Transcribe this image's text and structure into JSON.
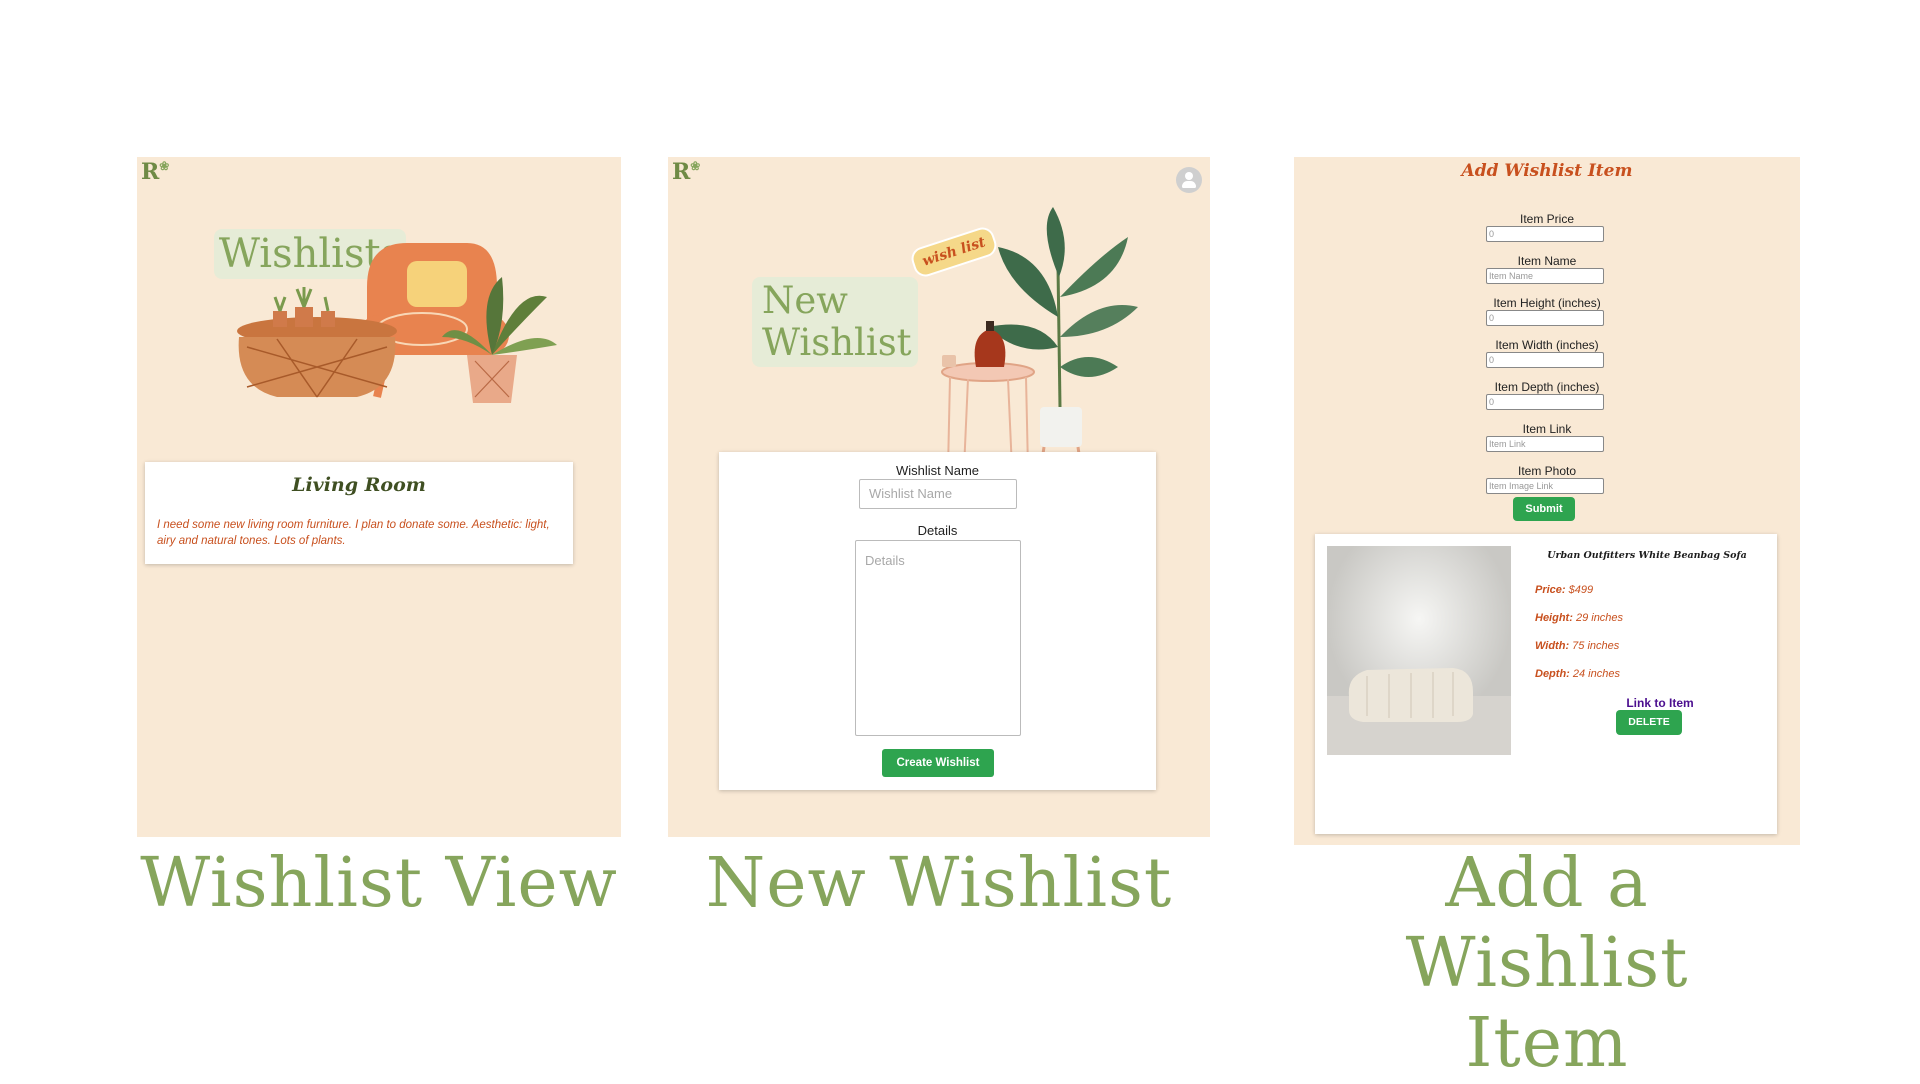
{
  "brand": {
    "logo": "R",
    "logo_mark": "❀"
  },
  "panel1": {
    "heading": "Wishlists",
    "card_title": "Living Room",
    "card_description": "I need some new living room furniture. I plan to donate some. Aesthetic: light, airy and natural tones. Lots of plants."
  },
  "panel2": {
    "heading_line1": "New",
    "heading_line2": "Wishlist",
    "sticker": "wish list",
    "name_label": "Wishlist Name",
    "name_placeholder": "Wishlist Name",
    "details_label": "Details",
    "details_placeholder": "Details",
    "create_button": "Create Wishlist"
  },
  "panel3": {
    "title": "Add Wishlist Item",
    "fields": [
      {
        "label": "Item Price",
        "placeholder": "0"
      },
      {
        "label": "Item Name",
        "placeholder": "Item Name"
      },
      {
        "label": "Item Height (inches)",
        "placeholder": "0"
      },
      {
        "label": "Item Width (inches)",
        "placeholder": "0"
      },
      {
        "label": "Item Depth (inches)",
        "placeholder": "0"
      },
      {
        "label": "Item Link",
        "placeholder": "Item Link"
      },
      {
        "label": "Item Photo",
        "placeholder": "Item Image Link"
      }
    ],
    "submit": "Submit",
    "item": {
      "name": "Urban Outfitters White Beanbag Sofa",
      "price_label": "Price:",
      "price": "$499",
      "height_label": "Height:",
      "height": "29 inches",
      "width_label": "Width:",
      "width": "75 inches",
      "depth_label": "Depth:",
      "depth": "24 inches",
      "link_text": "Link to Item",
      "delete_button": "DELETE"
    }
  },
  "captions": {
    "left": "Wishlist View",
    "middle": "New Wishlist",
    "right_line1": "Add a Wishlist",
    "right_line2": "Item"
  },
  "colors": {
    "panel_bg": "#f9e9d5",
    "caption_green": "#86a55c",
    "accent_orange": "#c8501e",
    "button_green": "#2ea44f",
    "link_purple": "#4b0e8f"
  }
}
